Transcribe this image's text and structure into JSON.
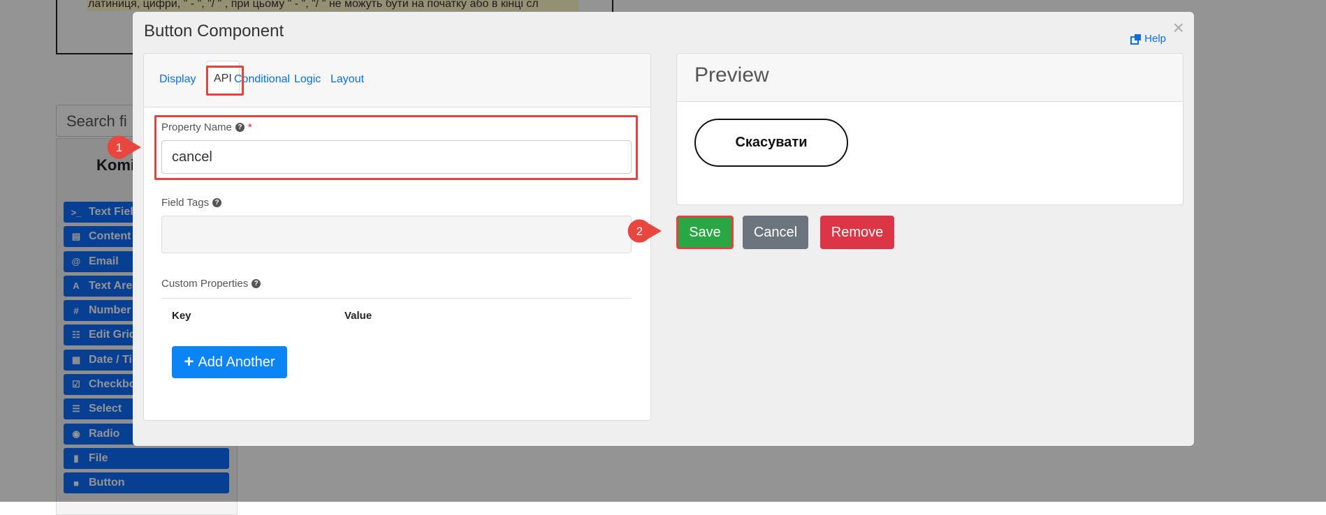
{
  "background": {
    "note_text": "латиниця, цифри, \" - \", \"/ \" , при цьому  \" - \", \"/ \" не можуть бути на початку або в кінці сл",
    "search_placeholder": "Search fi",
    "panel_title": "Komi",
    "components": [
      {
        "label": "Text Fiel",
        "icon": "terminal-icon",
        "glyph": ">_"
      },
      {
        "label": "Content",
        "icon": "html5-icon",
        "glyph": "▤"
      },
      {
        "label": "Email",
        "icon": "at-icon",
        "glyph": "@"
      },
      {
        "label": "Text Are",
        "icon": "font-icon",
        "glyph": "A"
      },
      {
        "label": "Number",
        "icon": "hash-icon",
        "glyph": "#"
      },
      {
        "label": "Edit Grid",
        "icon": "tasks-icon",
        "glyph": "☷"
      },
      {
        "label": "Date / Ti",
        "icon": "calendar-icon",
        "glyph": "▦"
      },
      {
        "label": "Checkbo",
        "icon": "checkbox-icon",
        "glyph": "☑"
      },
      {
        "label": "Select",
        "icon": "list-icon",
        "glyph": "☰"
      },
      {
        "label": "Radio",
        "icon": "radio-icon",
        "glyph": "◉"
      },
      {
        "label": "File",
        "icon": "file-icon",
        "glyph": "▮"
      },
      {
        "label": "Button",
        "icon": "stop-icon",
        "glyph": "■"
      }
    ]
  },
  "modal": {
    "title": "Button Component",
    "close": "×",
    "help": "Help",
    "tabs": [
      "Display",
      "API",
      "Conditional",
      "Logic",
      "Layout"
    ],
    "active_tab": "API",
    "property_name": {
      "label": "Property Name",
      "required_mark": "*",
      "value": "cancel"
    },
    "field_tags": {
      "label": "Field Tags"
    },
    "custom_properties": {
      "label": "Custom Properties",
      "key_header": "Key",
      "value_header": "Value"
    },
    "add_another": "Add Another",
    "preview": {
      "title": "Preview",
      "button_label": "Скасувати"
    },
    "actions": {
      "save": "Save",
      "cancel": "Cancel",
      "remove": "Remove"
    }
  },
  "annotations": {
    "step1": "1",
    "step2": "2"
  },
  "colors": {
    "accent": "#0b84f6",
    "highlight": "#e0443e",
    "save": "#28a745",
    "cancel": "#6c757d",
    "remove": "#dc3545"
  }
}
